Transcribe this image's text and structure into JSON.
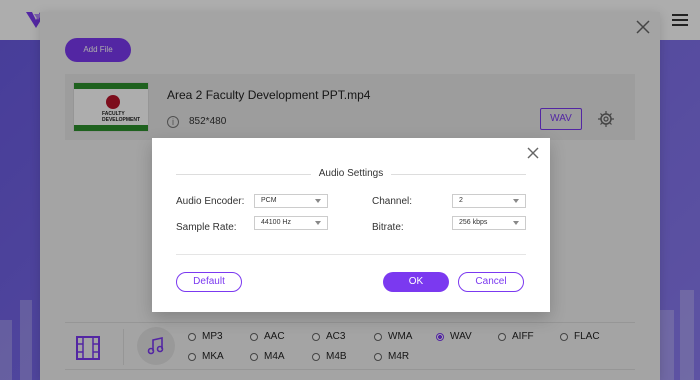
{
  "colors": {
    "accent": "#7b39f0",
    "background_purple": "#6c5ce7",
    "panel": "#f2f2f2"
  },
  "add_file": {
    "label": "Add File"
  },
  "file": {
    "name": "Area 2 Faculty Development PPT.mp4",
    "resolution": "852*480",
    "format_button": "WAV",
    "thumbnail_text": "FACULTY DEVELOPMENT"
  },
  "formats": {
    "row1": [
      "MP3",
      "AAC",
      "AC3",
      "WMA",
      "WAV",
      "AIFF",
      "FLAC"
    ],
    "row2": [
      "MKA",
      "M4A",
      "M4B",
      "M4R"
    ],
    "selected": "WAV"
  },
  "modal": {
    "title": "Audio Settings",
    "fields": {
      "encoder_label": "Audio Encoder:",
      "encoder_value": "PCM",
      "sample_rate_label": "Sample Rate:",
      "sample_rate_value": "44100 Hz",
      "channel_label": "Channel:",
      "channel_value": "2",
      "bitrate_label": "Bitrate:",
      "bitrate_value": "256 kbps"
    },
    "buttons": {
      "default": "Default",
      "ok": "OK",
      "cancel": "Cancel"
    }
  },
  "icons": {
    "logo": "logo-icon",
    "menu": "hamburger-menu-icon",
    "close": "close-icon",
    "info": "info-icon",
    "gear": "gear-icon",
    "video": "film-icon",
    "audio": "music-note-icon",
    "dropdown": "chevron-down-icon"
  }
}
